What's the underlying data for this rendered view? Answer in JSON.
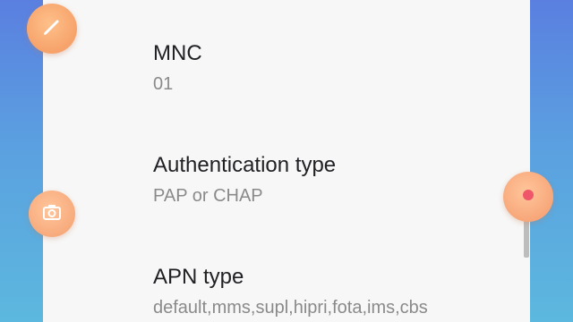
{
  "settings": [
    {
      "title": "MNC",
      "value": "01"
    },
    {
      "title": "Authentication type",
      "value": "PAP or CHAP"
    },
    {
      "title": "APN type",
      "value": "default,mms,supl,hipri,fota,ims,cbs"
    }
  ],
  "floating_buttons": {
    "edit": {
      "icon": "pencil-icon"
    },
    "camera": {
      "icon": "camera-icon"
    },
    "record": {
      "icon": "record-icon"
    }
  },
  "colors": {
    "background_top": "#5a7fe0",
    "background_bottom": "#5cb8de",
    "panel": "#f7f7f7",
    "accent": "#f6a26a",
    "record_dot": "#f0566a"
  }
}
